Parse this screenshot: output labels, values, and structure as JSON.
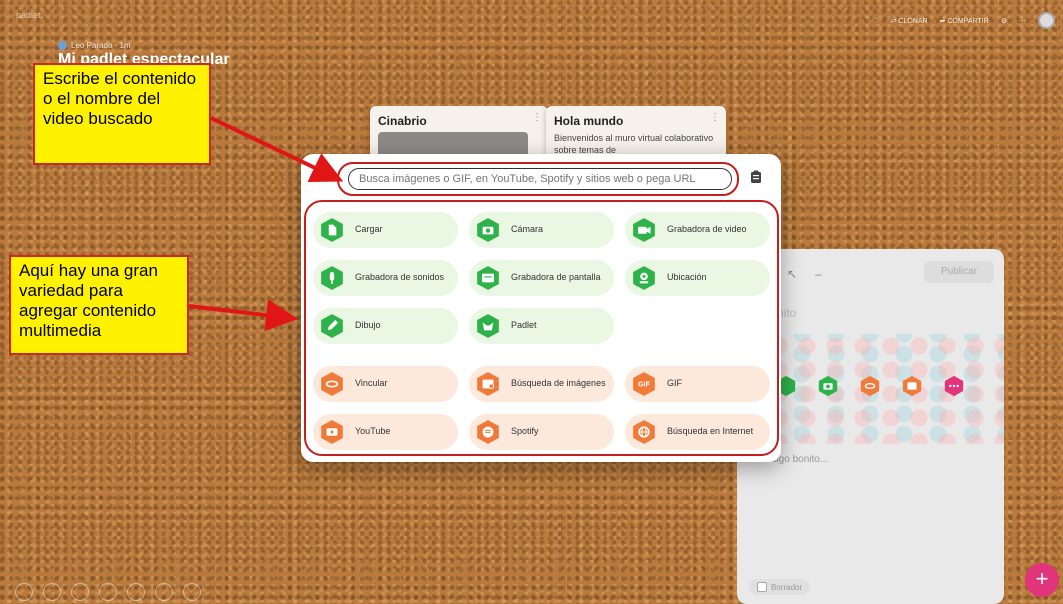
{
  "header": {
    "logo": "padlet",
    "author": "Leo Parada · 1m",
    "title": "Mi padlet espectacular",
    "actions": [
      "♡",
      "⇄ CLONAR",
      "➦ COMPARTIR",
      "⚙",
      "⋯"
    ]
  },
  "cards": [
    {
      "title": "Cinabrio",
      "body": ""
    },
    {
      "title": "Hola mundo",
      "body": "Bienvenidos al muro virtual colaborativo sobre temas de"
    }
  ],
  "modal": {
    "search_placeholder": "Busca imágenes o GIF, en YouTube, Spotify y sitios web o pega URL",
    "items": [
      {
        "label": "Cargar",
        "icon": "upload-icon",
        "color": "#2eb24a"
      },
      {
        "label": "Cámara",
        "icon": "camera-icon",
        "color": "#2eb24a"
      },
      {
        "label": "Grabadora de video",
        "icon": "video-camera-icon",
        "color": "#2eb24a"
      },
      {
        "label": "Grabadora de sonidos",
        "icon": "microphone-icon",
        "color": "#2eb24a"
      },
      {
        "label": "Grabadora de pantalla",
        "icon": "screen-recorder-icon",
        "color": "#2eb24a"
      },
      {
        "label": "Ubicación",
        "icon": "location-icon",
        "color": "#2eb24a"
      },
      {
        "label": "Dibujo",
        "icon": "pencil-icon",
        "color": "#2eb24a"
      },
      {
        "label": "Padlet",
        "icon": "padlet-icon",
        "color": "#2eb24a"
      },
      {
        "label": "Vincular",
        "icon": "link-icon",
        "color": "#f07a3a"
      },
      {
        "label": "Búsqueda de imágenes",
        "icon": "image-search-icon",
        "color": "#f07a3a"
      },
      {
        "label": "GIF",
        "icon": "gif-icon",
        "color": "#f07a3a"
      },
      {
        "label": "YouTube",
        "icon": "youtube-icon",
        "color": "#f07a3a"
      },
      {
        "label": "Spotify",
        "icon": "spotify-icon",
        "color": "#f07a3a"
      },
      {
        "label": "Búsqueda en Internet",
        "icon": "web-search-icon",
        "color": "#f07a3a"
      }
    ]
  },
  "composer": {
    "publish": "Publicar",
    "title_hint": "nito",
    "body_hint": "be algo bonito...",
    "draft": "Borrador"
  },
  "annotations": {
    "note1": "Escribe el contenido o el nombre del video buscado",
    "note2": "Aquí hay una gran variedad para agregar contenido multimedia"
  },
  "fab_label": "+",
  "colors": {
    "annotation_bg": "#fff200",
    "annotation_border": "#c82828",
    "accent_pink": "#e0357a"
  }
}
